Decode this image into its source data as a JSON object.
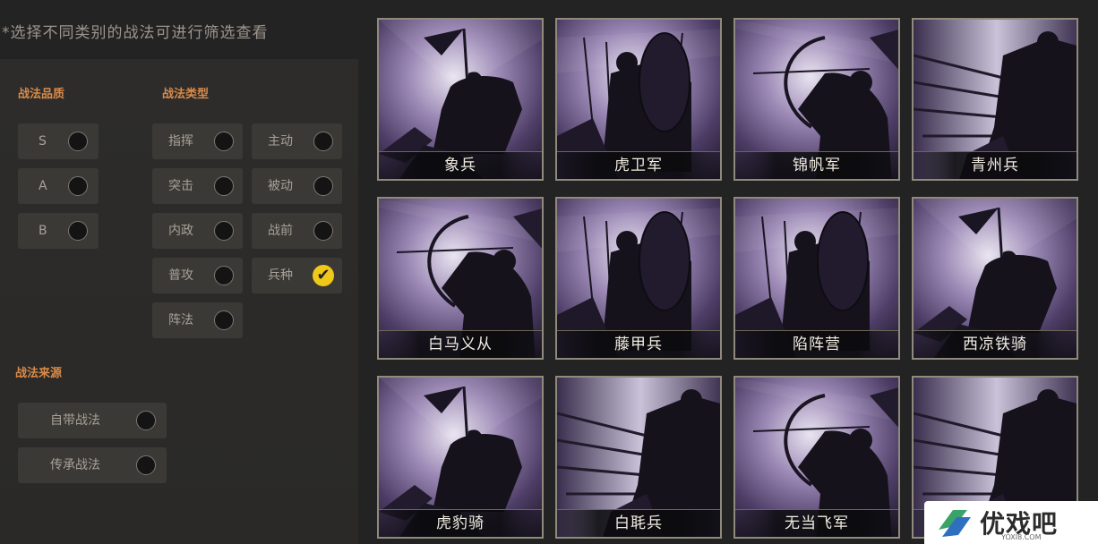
{
  "hint": "*选择不同类别的战法可进行筛选查看",
  "quality": {
    "title": "战法品质",
    "options": [
      {
        "label": "S",
        "selected": false
      },
      {
        "label": "A",
        "selected": false
      },
      {
        "label": "B",
        "selected": false
      }
    ]
  },
  "type": {
    "title": "战法类型",
    "options": [
      {
        "label": "指挥",
        "selected": false
      },
      {
        "label": "主动",
        "selected": false
      },
      {
        "label": "突击",
        "selected": false
      },
      {
        "label": "被动",
        "selected": false
      },
      {
        "label": "内政",
        "selected": false
      },
      {
        "label": "战前",
        "selected": false
      },
      {
        "label": "普攻",
        "selected": false
      },
      {
        "label": "兵种",
        "selected": true
      },
      {
        "label": "阵法",
        "selected": false
      }
    ]
  },
  "source": {
    "title": "战法来源",
    "options": [
      {
        "label": "自带战法",
        "selected": false
      },
      {
        "label": "传承战法",
        "selected": false
      }
    ]
  },
  "cards": [
    {
      "name": "象兵",
      "art": "banner-rider"
    },
    {
      "name": "虎卫军",
      "art": "shield-infantry"
    },
    {
      "name": "锦帆军",
      "art": "archer"
    },
    {
      "name": "青州兵",
      "art": "spear-charge"
    },
    {
      "name": "白马义从",
      "art": "archer"
    },
    {
      "name": "藤甲兵",
      "art": "shield-infantry"
    },
    {
      "name": "陷阵营",
      "art": "shield-infantry"
    },
    {
      "name": "西凉铁骑",
      "art": "banner-rider"
    },
    {
      "name": "虎豹骑",
      "art": "banner-rider"
    },
    {
      "name": "白毦兵",
      "art": "spear-charge"
    },
    {
      "name": "无当飞军",
      "art": "archer"
    },
    {
      "name": "",
      "art": "spear-charge"
    }
  ],
  "watermark": {
    "text": "优戏吧",
    "url": "YOXI8.COM"
  },
  "colors": {
    "accent": "#d98a4a",
    "check": "#f0c818"
  }
}
